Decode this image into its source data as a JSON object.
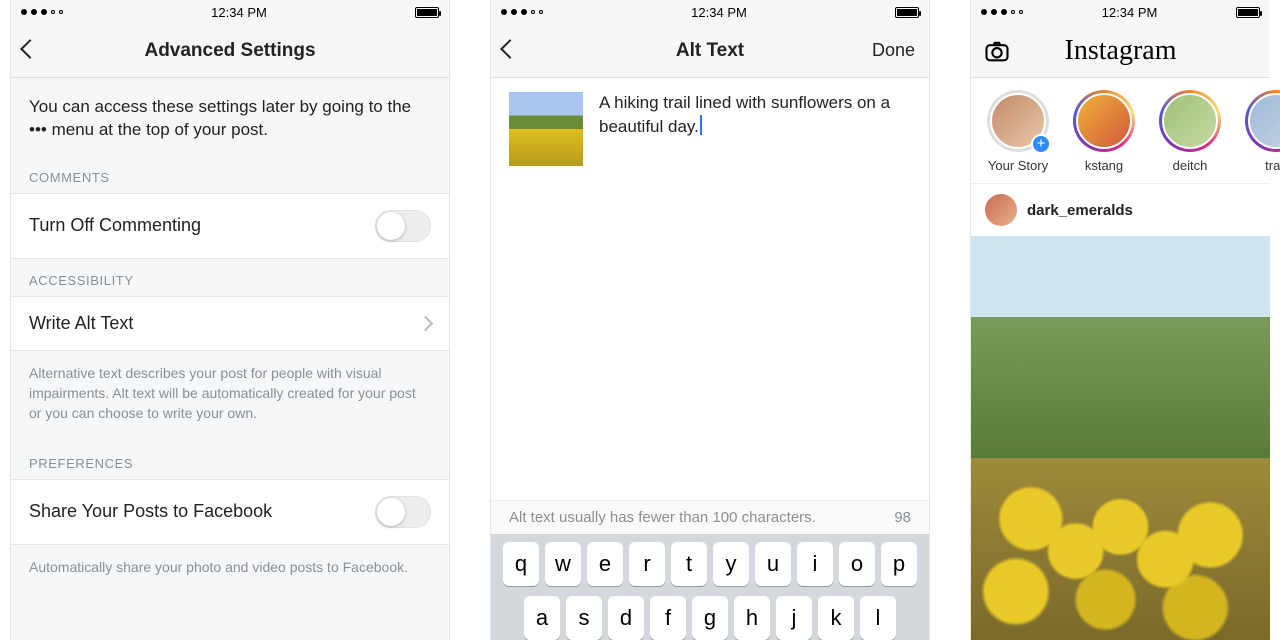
{
  "statusbar": {
    "time": "12:34 PM"
  },
  "screen1": {
    "title": "Advanced Settings",
    "intro": "You can access these settings later by going to the ••• menu at the top of your post.",
    "sections": {
      "comments": {
        "label": "COMMENTS",
        "toggle_label": "Turn Off Commenting"
      },
      "accessibility": {
        "label": "ACCESSIBILITY",
        "row_label": "Write Alt Text",
        "helper": "Alternative text describes your post for people with visual impairments. Alt text will be automatically created for your post or you can choose to write your own."
      },
      "preferences": {
        "label": "PREFERENCES",
        "toggle_label": "Share Your Posts to Facebook",
        "helper": "Automatically share your photo and video posts to Facebook."
      }
    }
  },
  "screen2": {
    "title": "Alt Text",
    "done": "Done",
    "alt_text_value": "A hiking trail lined with sunflowers on a beautiful day.",
    "hint": "Alt text usually has fewer than 100 characters.",
    "count": "98",
    "keyboard_row1": [
      "q",
      "w",
      "e",
      "r",
      "t",
      "y",
      "u",
      "i",
      "o",
      "p"
    ],
    "keyboard_row2": [
      "a",
      "s",
      "d",
      "f",
      "g",
      "h",
      "j",
      "k",
      "l"
    ]
  },
  "screen3": {
    "brand": "Instagram",
    "stories": [
      {
        "label": "Your Story"
      },
      {
        "label": "kstang"
      },
      {
        "label": "deitch"
      },
      {
        "label": "trav"
      }
    ],
    "post_user": "dark_emeralds"
  }
}
